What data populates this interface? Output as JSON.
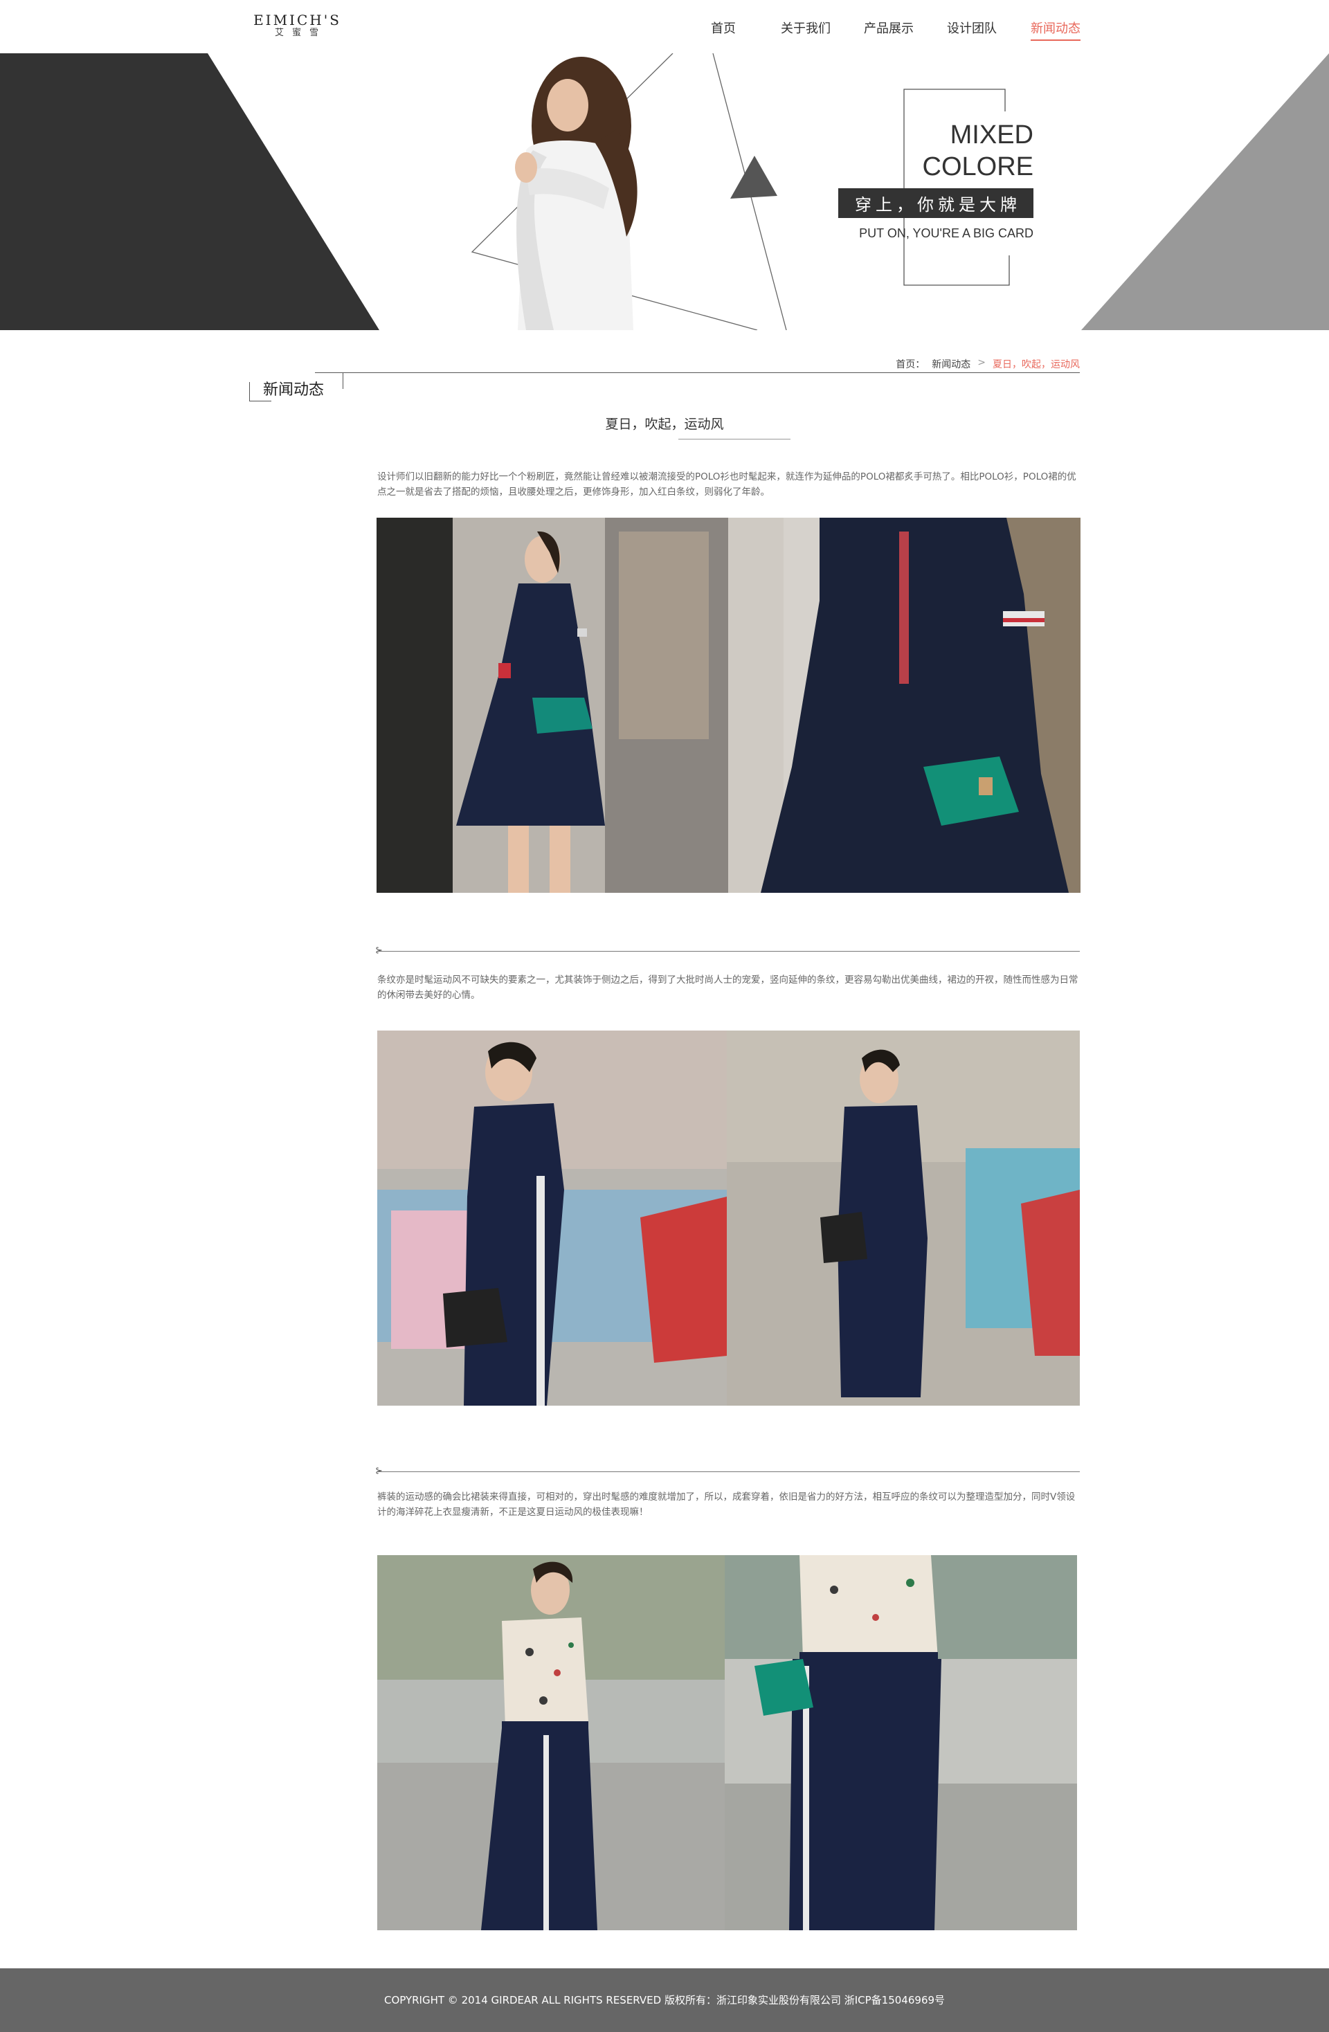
{
  "brand": {
    "logo_en": "EIMICH'S",
    "logo_cn": "艾蜜雪"
  },
  "nav": {
    "items": [
      {
        "label": "首页",
        "active": false
      },
      {
        "label": "关于我们",
        "active": false
      },
      {
        "label": "产品展示",
        "active": false
      },
      {
        "label": "设计团队",
        "active": false
      },
      {
        "label": "新闻动态",
        "active": true
      }
    ]
  },
  "banner": {
    "title_line1": "MIXED",
    "title_line2": "COLORE",
    "tag": "穿上，你就是大牌",
    "subtitle": "PUT ON, YOU'RE A BIG CARD"
  },
  "breadcrumb": {
    "home": "首页：",
    "section": "新闻动态",
    "separator": ">",
    "current": "夏日，吹起，运动风"
  },
  "section": {
    "heading": "新闻动态"
  },
  "article": {
    "title": "夏日，吹起，运动风",
    "paragraphs": [
      "设计师们以旧翻新的能力好比一个个粉刷匠，竟然能让曾经难以被潮流接受的POLO衫也时髦起来，就连作为延伸品的POLO裙都炙手可热了。相比POLO衫，POLO裙的优点之一就是省去了搭配的烦恼，且收腰处理之后，更修饰身形，加入红白条纹，则弱化了年龄。",
      "条纹亦是时髦运动风不可缺失的要素之一，尤其装饰于侧边之后，得到了大批时尚人士的宠爱，竖向延伸的条纹，更容易勾勒出优美曲线，裙边的开衩，随性而性感为日常的休闲带去美好的心情。",
      "裤装的运动感的确会比裙装来得直接，可相对的，穿出时髦感的难度就增加了，所以，成套穿着，依旧是省力的好方法，相互呼应的条纹可以为整理造型加分，同时V领设计的海洋碎花上衣显瘦清新，不正是这夏日运动风的极佳表现嘛！"
    ],
    "divider_mark": "⊱"
  },
  "colors": {
    "accent": "#e8675a",
    "banner_dark": "#333333",
    "banner_gray": "#999999",
    "footer_bg": "#666666",
    "navy": "#1c2540"
  },
  "footer": {
    "text": "COPYRIGHT © 2014 GIRDEAR ALL RIGHTS RESERVED 版权所有：浙江印象实业股份有限公司  浙ICP备15046969号"
  }
}
